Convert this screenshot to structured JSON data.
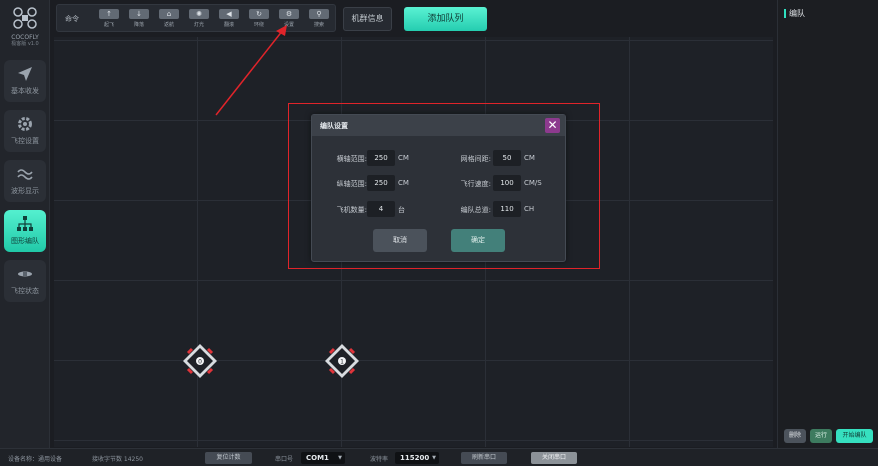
{
  "logo": {
    "brand": "COCOFLY",
    "version": "极客版 v1.0"
  },
  "sidebar": {
    "items": [
      {
        "label": "基本收发",
        "icon": "send-icon"
      },
      {
        "label": "飞控设置",
        "icon": "gear-icon"
      },
      {
        "label": "波形显示",
        "icon": "wave-icon"
      },
      {
        "label": "图形编队",
        "icon": "formation-icon",
        "active": true
      },
      {
        "label": "飞控状态",
        "icon": "drone-status-icon"
      }
    ]
  },
  "toolbar": {
    "label": "命令",
    "buttons": [
      {
        "caption": "起飞",
        "glyph": "↑"
      },
      {
        "caption": "降落",
        "glyph": "↓"
      },
      {
        "caption": "返航",
        "glyph": "⌂"
      },
      {
        "caption": "灯光",
        "glyph": "✺"
      },
      {
        "caption": "翻滚",
        "glyph": "◀"
      },
      {
        "caption": "环绕",
        "glyph": "↻"
      },
      {
        "caption": "设置",
        "glyph": "⚙"
      },
      {
        "caption": "搜索",
        "glyph": "⚲"
      }
    ],
    "group_info": "机群信息",
    "add_queue": "添加队列"
  },
  "drones": [
    {
      "number": "0"
    },
    {
      "number": "1"
    }
  ],
  "dialog": {
    "title": "编队设置",
    "close_glyph": "✕",
    "fields": {
      "h_range": {
        "label": "横轴范围:",
        "value": "250",
        "unit": "CM"
      },
      "v_range": {
        "label": "纵轴范围:",
        "value": "250",
        "unit": "CM"
      },
      "count": {
        "label": "飞机数量:",
        "value": "4",
        "unit": "台"
      },
      "grid": {
        "label": "网格间距:",
        "value": "50",
        "unit": "CM"
      },
      "speed": {
        "label": "飞行速度:",
        "value": "100",
        "unit": "CM/S"
      },
      "channel": {
        "label": "编队总道:",
        "value": "110",
        "unit": "CH"
      }
    },
    "cancel": "取消",
    "ok": "确定"
  },
  "right_panel": {
    "title": "编队",
    "buttons": {
      "delete": "删除",
      "run": "运行",
      "start": "开始编队"
    }
  },
  "statusbar": {
    "device": "设备名称：通用设备",
    "bytes": "接收字节数 14250",
    "reset_count": "复位计数",
    "port_label": "串口号",
    "port_value": "COM1",
    "baud_label": "波特率",
    "baud_value": "115200",
    "refresh": "刷新串口",
    "close": "关闭串口"
  },
  "colors": {
    "accent": "#2fe0c0",
    "annotation": "#e0242a",
    "close_button": "#8d3a8e"
  }
}
